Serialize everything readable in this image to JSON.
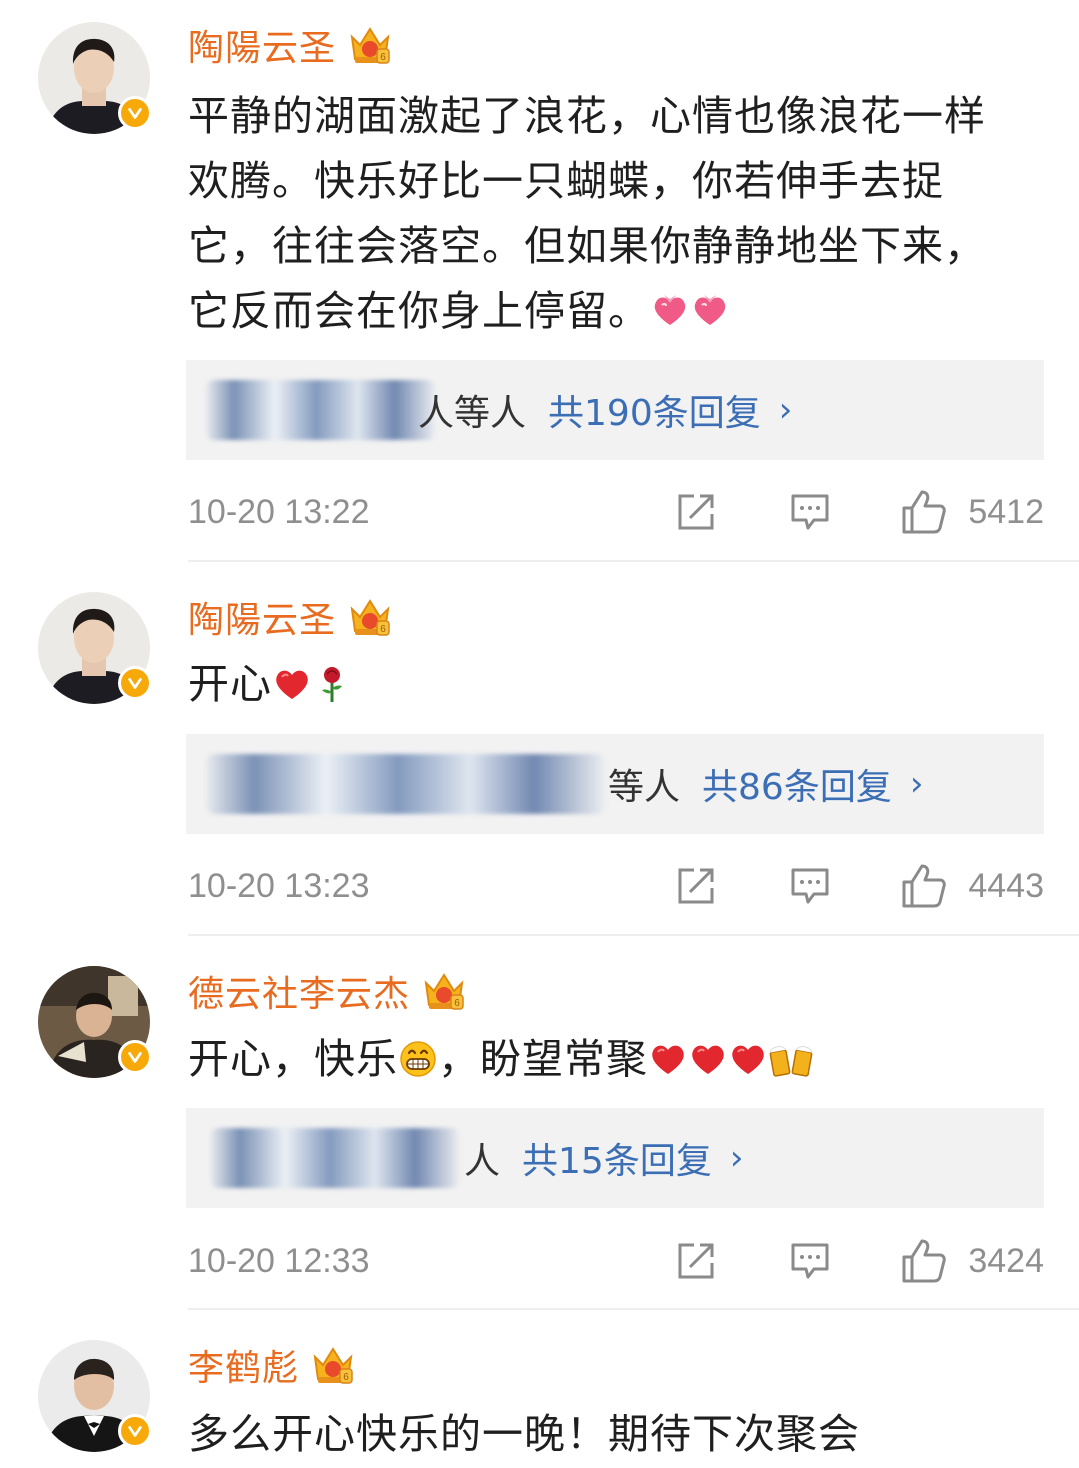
{
  "colors": {
    "username": "#e86b1f",
    "link": "#3b6eb5",
    "meta": "#8f8f8f",
    "reply_bg": "#f2f2f2",
    "badge": "#f7a90a"
  },
  "comments": [
    {
      "username": "陶陽云圣",
      "badge_icon": "crown-vip-icon",
      "lines": [
        "平静的湖面激起了浪花，心情也像浪花一样",
        "欢腾。快乐好比一只蝴蝶，你若伸手去捉",
        "它，往往会落空。但如果你静静地坐下来，",
        "它反而会在你身上停留。"
      ],
      "emojis": [
        "heart-ribbon-emoji",
        "heart-ribbon-emoji"
      ],
      "reply_suffix": "人等人",
      "reply_count": "共190条回复",
      "timestamp": "10-20 13:22",
      "likes": "5412"
    },
    {
      "username": "陶陽云圣",
      "badge_icon": "crown-vip-icon",
      "lines": [
        "开心"
      ],
      "emojis": [
        "red-heart-emoji",
        "rose-emoji"
      ],
      "reply_suffix": "等人",
      "reply_count": "共86条回复",
      "timestamp": "10-20 13:23",
      "likes": "4443"
    },
    {
      "username": "德云社李云杰",
      "badge_icon": "crown-vip-icon",
      "line_parts": [
        "开心，快乐",
        "，盼望常聚"
      ],
      "emojis": [
        "grin-emoji",
        "red-heart-emoji",
        "red-heart-emoji",
        "red-heart-emoji",
        "beer-cheers-emoji"
      ],
      "reply_suffix": "人",
      "reply_count": "共15条回复",
      "timestamp": "10-20 12:33",
      "likes": "3424"
    },
    {
      "username": "李鹤彪",
      "badge_icon": "crown-vip-icon",
      "lines": [
        "多么开心快乐的一晚！期待下次聚会"
      ]
    }
  ],
  "reply_arrow": "›"
}
